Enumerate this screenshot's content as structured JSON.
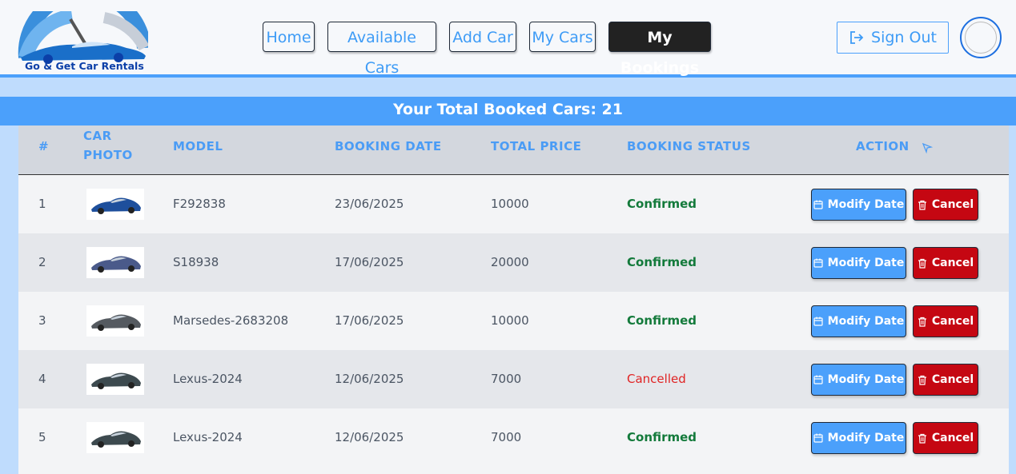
{
  "brand": {
    "name": "Go & Get Car Rentals"
  },
  "nav": {
    "home": "Home",
    "available": "Available Cars",
    "add": "Add Car",
    "mycars": "My Cars",
    "bookings": "My Bookings",
    "signout": "Sign Out"
  },
  "banner": {
    "text": "Your Total Booked Cars: 21"
  },
  "table": {
    "headers": {
      "num": "#",
      "photo_line1": "CAR",
      "photo_line2": "PHOTO",
      "model": "MODEL",
      "date": "BOOKING DATE",
      "price": "TOTAL PRICE",
      "status": "BOOKING STATUS",
      "action": "ACTION"
    },
    "modify_label": "Modify Date",
    "cancel_label": "Cancel",
    "rows": [
      {
        "num": "1",
        "model": "F292838",
        "date": "23/06/2025",
        "price": "10000",
        "status": "Confirmed",
        "car_color": "#1e4f9c"
      },
      {
        "num": "2",
        "model": "S18938",
        "date": "17/06/2025",
        "price": "20000",
        "status": "Confirmed",
        "car_color": "#4a5a8a"
      },
      {
        "num": "3",
        "model": "Marsedes-2683208",
        "date": "17/06/2025",
        "price": "10000",
        "status": "Confirmed",
        "car_color": "#555a60"
      },
      {
        "num": "4",
        "model": "Lexus-2024",
        "date": "12/06/2025",
        "price": "7000",
        "status": "Cancelled",
        "car_color": "#3d4a4f"
      },
      {
        "num": "5",
        "model": "Lexus-2024",
        "date": "12/06/2025",
        "price": "7000",
        "status": "Confirmed",
        "car_color": "#3d4a4f"
      }
    ]
  },
  "colors": {
    "accent": "#4ba0fb",
    "confirmed": "#137a3b",
    "cancelled": "#e02424",
    "cancel_button": "#c50712"
  }
}
